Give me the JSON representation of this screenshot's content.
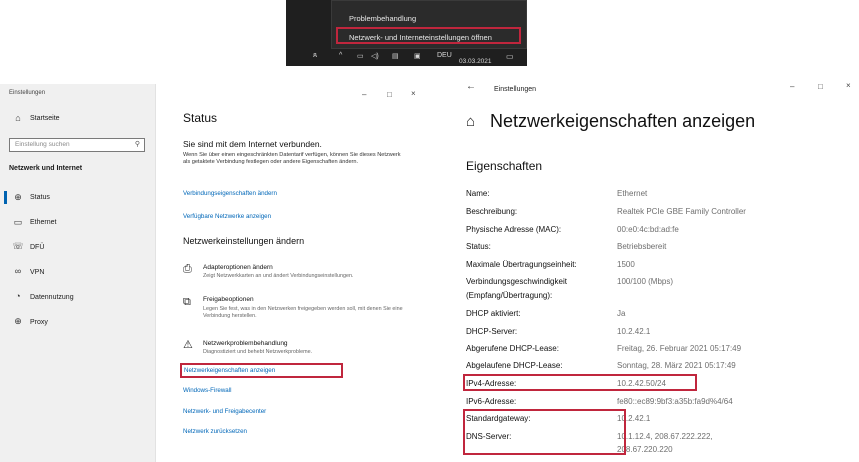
{
  "taskbar": {
    "menu_items": [
      "Problembehandlung",
      "Netzwerk- und Interneteinstellungen öffnen"
    ],
    "tray_lang": "DEU",
    "tray_date": "03.03.2021",
    "icons": [
      "people-icon",
      "chevron-up-icon",
      "network-icon",
      "volume-icon",
      "keyboard-icon",
      "notification-icon"
    ]
  },
  "settings_window": {
    "title": "Einstellungen",
    "controls": [
      "–",
      "□",
      "×"
    ],
    "sidebar": {
      "home": "Startseite",
      "search_placeholder": "Einstellung suchen",
      "section": "Netzwerk und Internet",
      "items": [
        {
          "label": "Status",
          "icon": "status-icon"
        },
        {
          "label": "Ethernet",
          "icon": "ethernet-icon"
        },
        {
          "label": "DFÜ",
          "icon": "dialup-icon"
        },
        {
          "label": "VPN",
          "icon": "vpn-icon"
        },
        {
          "label": "Datennutzung",
          "icon": "data-usage-icon"
        },
        {
          "label": "Proxy",
          "icon": "proxy-icon"
        }
      ]
    },
    "main": {
      "title": "Status",
      "connected_heading": "Sie sind mit dem Internet verbunden.",
      "connected_text": "Wenn Sie über einen eingeschränkten Datentarif verfügen, können Sie dieses Netzwerk als getaktete Verbindung festlegen oder andere Eigenschaften ändern.",
      "link_change_props": "Verbindungseigenschaften ändern",
      "link_available": "Verfügbare Netzwerke anzeigen",
      "section_heading": "Netzwerkeinstellungen ändern",
      "options": [
        {
          "title": "Adapteroptionen ändern",
          "desc": "Zeigt Netzwerkkarten an und ändert Verbindungseinstellungen.",
          "icon": "adapter-icon"
        },
        {
          "title": "Freigabeoptionen",
          "desc": "Legen Sie fest, was in den Netzwerken freigegeben werden soll, mit denen Sie eine Verbindung herstellen.",
          "icon": "sharing-icon"
        },
        {
          "title": "Netzwerkproblembehandlung",
          "desc": "Diagnostiziert und behebt Netzwerkprobleme.",
          "icon": "warning-icon"
        }
      ],
      "links": [
        "Netzwerkeigenschaften anzeigen",
        "Windows-Firewall",
        "Netzwerk- und Freigabecenter",
        "Netzwerk zurücksetzen"
      ]
    }
  },
  "properties_window": {
    "title": "Einstellungen",
    "back": "←",
    "controls": [
      "–",
      "□",
      "×"
    ],
    "heading": "Netzwerkeigenschaften anzeigen",
    "section": "Eigenschaften",
    "rows": [
      {
        "label": "Name:",
        "value": "Ethernet"
      },
      {
        "label": "Beschreibung:",
        "value": "Realtek PCIe GBE Family Controller"
      },
      {
        "label": "Physische Adresse (MAC):",
        "value": "00:e0:4c:bd:ad:fe"
      },
      {
        "label": "Status:",
        "value": "Betriebsbereit"
      },
      {
        "label": "Maximale Übertragungseinheit:",
        "value": "1500"
      },
      {
        "label": "Verbindungsgeschwindigkeit",
        "label2": "(Empfang/Übertragung):",
        "value": "100/100 (Mbps)"
      },
      {
        "label": "DHCP aktiviert:",
        "value": "Ja"
      },
      {
        "label": "DHCP-Server:",
        "value": "10.2.42.1"
      },
      {
        "label": "Abgerufene DHCP-Lease:",
        "value": "Freitag, 26. Februar 2021 05:17:49"
      },
      {
        "label": "Abgelaufene DHCP-Lease:",
        "value": "Sonntag, 28. März 2021 05:17:49"
      },
      {
        "label": "IPv4-Adresse:",
        "value": "10.2.42.50/24"
      },
      {
        "label": "IPv6-Adresse:",
        "value": "fe80::ec89:9bf3:a35b:fa9d%4/64"
      },
      {
        "label": "Standardgateway:",
        "value": "10.2.42.1"
      },
      {
        "label": "DNS-Server:",
        "value": "10.1.12.4, 208.67.222.222,",
        "value2": "208.67.220.220"
      }
    ]
  },
  "colors": {
    "highlight": "#c0263d",
    "link": "#0067b8",
    "accent": "#0063b1"
  }
}
